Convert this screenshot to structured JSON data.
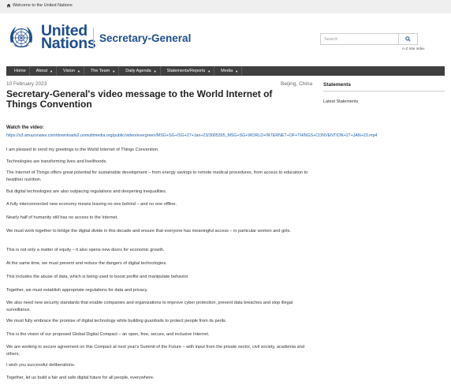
{
  "topbar": {
    "welcome": "Welcome to the United Nations"
  },
  "header": {
    "org_line1": "United",
    "org_line2": "Nations",
    "section_title": "Secretary-General",
    "search_placeholder": "Search",
    "az_index": "A-Z Site Index"
  },
  "nav": {
    "items": [
      {
        "label": "Home",
        "dropdown": false
      },
      {
        "label": "About",
        "dropdown": true
      },
      {
        "label": "Vision",
        "dropdown": true
      },
      {
        "label": "The Team",
        "dropdown": true
      },
      {
        "label": "Daily Agenda",
        "dropdown": true
      },
      {
        "label": "Statements/Reports",
        "dropdown": true
      },
      {
        "label": "Media",
        "dropdown": true
      }
    ]
  },
  "article": {
    "date": "10 February 2023",
    "location": "Beijing, China",
    "title": "Secretary-General's video message to the World Internet of Things Convention",
    "watch_label": "Watch the video:",
    "video_url": "https://s3.amazonaws.com/downloads2.unmultimedia.org/public/video/evergreen/MSG+SG+/SG+27+Jan+23/3005395_MSG+SG+WORLD+INTERNET+OF+THINGS+CONVENTION+27+JAN+23.mp4",
    "paragraphs": [
      "I am pleased to send my greetings to the World Internet of Things Convention.",
      "Technologies are transforming lives and livelihoods.",
      "The Internet of Things offers great potential for sustainable development – from energy savings to remote medical procedures, from access to education to healthier nutrition.",
      "But digital technologies are also outpacing regulations and deepening inequalities.",
      "A fully interconnected new economy means leaving no one behind – and no one offline.",
      "Nearly half of humanity still has no access to the Internet.",
      "We must work together to bridge the digital divide in this decade and ensure that everyone has meaningful access – in particular women and girls.",
      "This is not only a matter of equity – it also opens new doors for economic growth.",
      "At the same time, we must prevent and reduce the dangers of digital technologies.",
      "This includes the abuse of data, which is being used to boost profits and manipulate behavior.",
      "Together, we must establish appropriate regulations for data and privacy.",
      "We also need new security standards that enable companies and organizations to improve cyber protection, prevent data breaches and stop illegal surveillance.",
      "We must fully embrace the promise of digital technology while building guardrails to protect people from its perils.",
      "This is the vision of our proposed Global Digital Compact – an open, free, secure, and inclusive Internet.",
      "We are working to secure agreement on this Compact at next year's Summit of the Future – with input from the private sector, civil society, academia and others.",
      "I wish you successful deliberations.",
      "Together, let us build a fair and safe digital future for all people, everywhere."
    ]
  },
  "sidebar": {
    "heading": "Statements",
    "latest": "Latest Statements"
  },
  "colors": {
    "brand_blue": "#1f4e8c",
    "nav_bg": "#3f3f3f",
    "link": "#1f5fa8"
  }
}
